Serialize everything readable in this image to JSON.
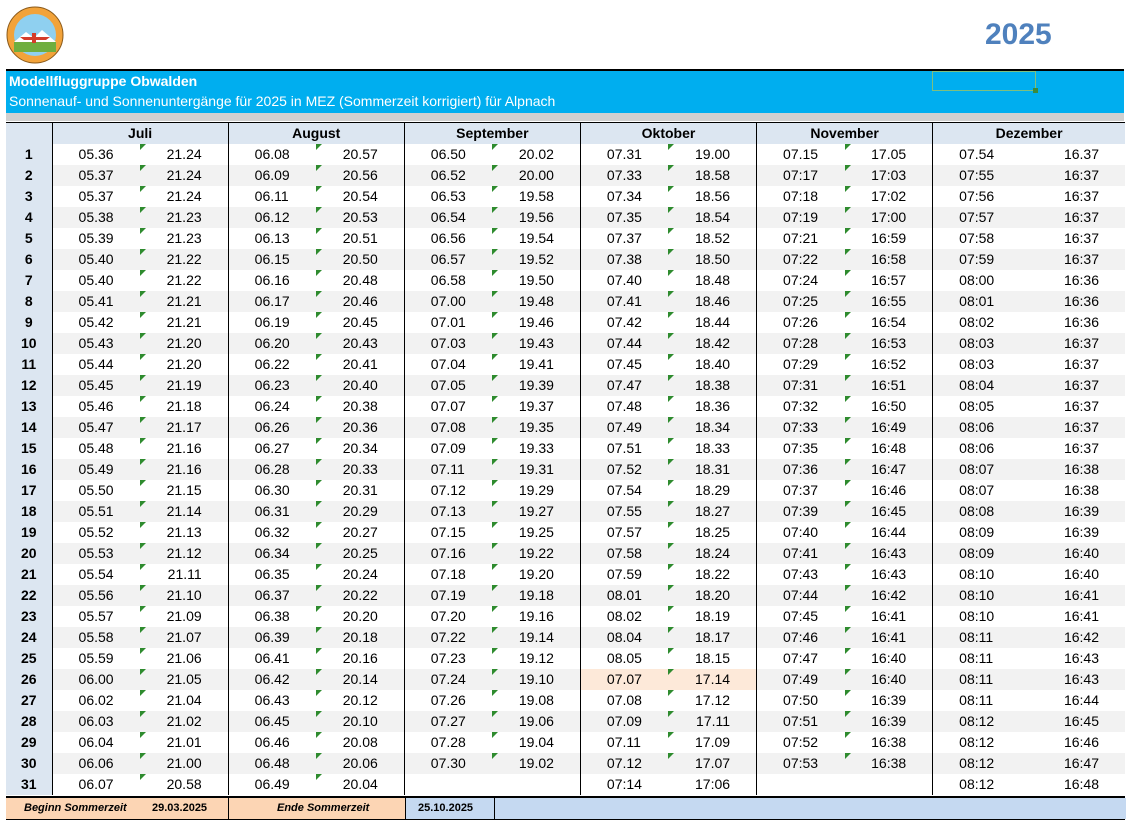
{
  "header": {
    "year": "2025",
    "club": "Modellfluggruppe Obwalden",
    "subtitle": "Sonnenauf- und Sonnenuntergänge für 2025 in MEZ (Sommerzeit korrigiert) für Alpnach"
  },
  "colors": {
    "banner": "#00aeef",
    "year": "#4f81bd",
    "header_bg": "#dce6f1",
    "highlight": "#fde9d9",
    "footer_orange": "#fcd5b4",
    "footer_blue": "#c5d9f1",
    "marker": "#2e8b2e"
  },
  "months": [
    "Juli",
    "August",
    "September",
    "Oktober",
    "November",
    "Dezember"
  ],
  "days": [
    "1",
    "2",
    "3",
    "4",
    "5",
    "6",
    "7",
    "8",
    "9",
    "10",
    "11",
    "12",
    "13",
    "14",
    "15",
    "16",
    "17",
    "18",
    "19",
    "20",
    "21",
    "22",
    "23",
    "24",
    "25",
    "26",
    "27",
    "28",
    "29",
    "30",
    "31"
  ],
  "juli": [
    [
      "05.36",
      "21.24"
    ],
    [
      "05.37",
      "21.24"
    ],
    [
      "05.37",
      "21.24"
    ],
    [
      "05.38",
      "21.23"
    ],
    [
      "05.39",
      "21.23"
    ],
    [
      "05.40",
      "21.22"
    ],
    [
      "05.40",
      "21.22"
    ],
    [
      "05.41",
      "21.21"
    ],
    [
      "05.42",
      "21.21"
    ],
    [
      "05.43",
      "21.20"
    ],
    [
      "05.44",
      "21.20"
    ],
    [
      "05.45",
      "21.19"
    ],
    [
      "05.46",
      "21.18"
    ],
    [
      "05.47",
      "21.17"
    ],
    [
      "05.48",
      "21.16"
    ],
    [
      "05.49",
      "21.16"
    ],
    [
      "05.50",
      "21.15"
    ],
    [
      "05.51",
      "21.14"
    ],
    [
      "05.52",
      "21.13"
    ],
    [
      "05.53",
      "21.12"
    ],
    [
      "05.54",
      "21.11"
    ],
    [
      "05.56",
      "21.10"
    ],
    [
      "05.57",
      "21.09"
    ],
    [
      "05.58",
      "21.07"
    ],
    [
      "05.59",
      "21.06"
    ],
    [
      "06.00",
      "21.05"
    ],
    [
      "06.02",
      "21.04"
    ],
    [
      "06.03",
      "21.02"
    ],
    [
      "06.04",
      "21.01"
    ],
    [
      "06.06",
      "21.00"
    ],
    [
      "06.07",
      "20.58"
    ]
  ],
  "august": [
    [
      "06.08",
      "20.57"
    ],
    [
      "06.09",
      "20.56"
    ],
    [
      "06.11",
      "20.54"
    ],
    [
      "06.12",
      "20.53"
    ],
    [
      "06.13",
      "20.51"
    ],
    [
      "06.15",
      "20.50"
    ],
    [
      "06.16",
      "20.48"
    ],
    [
      "06.17",
      "20.46"
    ],
    [
      "06.19",
      "20.45"
    ],
    [
      "06.20",
      "20.43"
    ],
    [
      "06.22",
      "20.41"
    ],
    [
      "06.23",
      "20.40"
    ],
    [
      "06.24",
      "20.38"
    ],
    [
      "06.26",
      "20.36"
    ],
    [
      "06.27",
      "20.34"
    ],
    [
      "06.28",
      "20.33"
    ],
    [
      "06.30",
      "20.31"
    ],
    [
      "06.31",
      "20.29"
    ],
    [
      "06.32",
      "20.27"
    ],
    [
      "06.34",
      "20.25"
    ],
    [
      "06.35",
      "20.24"
    ],
    [
      "06.37",
      "20.22"
    ],
    [
      "06.38",
      "20.20"
    ],
    [
      "06.39",
      "20.18"
    ],
    [
      "06.41",
      "20.16"
    ],
    [
      "06.42",
      "20.14"
    ],
    [
      "06.43",
      "20.12"
    ],
    [
      "06.45",
      "20.10"
    ],
    [
      "06.46",
      "20.08"
    ],
    [
      "06.48",
      "20.06"
    ],
    [
      "06.49",
      "20.04"
    ]
  ],
  "september": [
    [
      "06.50",
      "20.02"
    ],
    [
      "06.52",
      "20.00"
    ],
    [
      "06.53",
      "19.58"
    ],
    [
      "06.54",
      "19.56"
    ],
    [
      "06.56",
      "19.54"
    ],
    [
      "06.57",
      "19.52"
    ],
    [
      "06.58",
      "19.50"
    ],
    [
      "07.00",
      "19.48"
    ],
    [
      "07.01",
      "19.46"
    ],
    [
      "07.03",
      "19.43"
    ],
    [
      "07.04",
      "19.41"
    ],
    [
      "07.05",
      "19.39"
    ],
    [
      "07.07",
      "19.37"
    ],
    [
      "07.08",
      "19.35"
    ],
    [
      "07.09",
      "19.33"
    ],
    [
      "07.11",
      "19.31"
    ],
    [
      "07.12",
      "19.29"
    ],
    [
      "07.13",
      "19.27"
    ],
    [
      "07.15",
      "19.25"
    ],
    [
      "07.16",
      "19.22"
    ],
    [
      "07.18",
      "19.20"
    ],
    [
      "07.19",
      "19.18"
    ],
    [
      "07.20",
      "19.16"
    ],
    [
      "07.22",
      "19.14"
    ],
    [
      "07.23",
      "19.12"
    ],
    [
      "07.24",
      "19.10"
    ],
    [
      "07.26",
      "19.08"
    ],
    [
      "07.27",
      "19.06"
    ],
    [
      "07.28",
      "19.04"
    ],
    [
      "07.30",
      "19.02"
    ],
    [
      "",
      ""
    ]
  ],
  "oktober": [
    [
      "07.31",
      "19.00"
    ],
    [
      "07.33",
      "18.58"
    ],
    [
      "07.34",
      "18.56"
    ],
    [
      "07.35",
      "18.54"
    ],
    [
      "07.37",
      "18.52"
    ],
    [
      "07.38",
      "18.50"
    ],
    [
      "07.40",
      "18.48"
    ],
    [
      "07.41",
      "18.46"
    ],
    [
      "07.42",
      "18.44"
    ],
    [
      "07.44",
      "18.42"
    ],
    [
      "07.45",
      "18.40"
    ],
    [
      "07.47",
      "18.38"
    ],
    [
      "07.48",
      "18.36"
    ],
    [
      "07.49",
      "18.34"
    ],
    [
      "07.51",
      "18.33"
    ],
    [
      "07.52",
      "18.31"
    ],
    [
      "07.54",
      "18.29"
    ],
    [
      "07.55",
      "18.27"
    ],
    [
      "07.57",
      "18.25"
    ],
    [
      "07.58",
      "18.24"
    ],
    [
      "07.59",
      "18.22"
    ],
    [
      "08.01",
      "18.20"
    ],
    [
      "08.02",
      "18.19"
    ],
    [
      "08.04",
      "18.17"
    ],
    [
      "08.05",
      "18.15"
    ],
    [
      "07.07",
      "17.14"
    ],
    [
      "07.08",
      "17.12"
    ],
    [
      "07.09",
      "17.11"
    ],
    [
      "07.11",
      "17.09"
    ],
    [
      "07.12",
      "17.07"
    ],
    [
      "07:14",
      "17:06"
    ]
  ],
  "november": [
    [
      "07.15",
      "17.05"
    ],
    [
      "07:17",
      "17:03"
    ],
    [
      "07:18",
      "17:02"
    ],
    [
      "07:19",
      "17:00"
    ],
    [
      "07:21",
      "16:59"
    ],
    [
      "07:22",
      "16:58"
    ],
    [
      "07:24",
      "16:57"
    ],
    [
      "07:25",
      "16:55"
    ],
    [
      "07:26",
      "16:54"
    ],
    [
      "07:28",
      "16:53"
    ],
    [
      "07:29",
      "16:52"
    ],
    [
      "07:31",
      "16:51"
    ],
    [
      "07:32",
      "16:50"
    ],
    [
      "07:33",
      "16:49"
    ],
    [
      "07:35",
      "16:48"
    ],
    [
      "07:36",
      "16:47"
    ],
    [
      "07:37",
      "16:46"
    ],
    [
      "07:39",
      "16:45"
    ],
    [
      "07:40",
      "16:44"
    ],
    [
      "07:41",
      "16:43"
    ],
    [
      "07:43",
      "16:43"
    ],
    [
      "07:44",
      "16:42"
    ],
    [
      "07:45",
      "16:41"
    ],
    [
      "07:46",
      "16:41"
    ],
    [
      "07:47",
      "16:40"
    ],
    [
      "07:49",
      "16:40"
    ],
    [
      "07:50",
      "16:39"
    ],
    [
      "07:51",
      "16:39"
    ],
    [
      "07:52",
      "16:38"
    ],
    [
      "07:53",
      "16:38"
    ],
    [
      "",
      ""
    ]
  ],
  "dezember": [
    [
      "07.54",
      "16.37"
    ],
    [
      "07:55",
      "16:37"
    ],
    [
      "07:56",
      "16:37"
    ],
    [
      "07:57",
      "16:37"
    ],
    [
      "07:58",
      "16:37"
    ],
    [
      "07:59",
      "16:37"
    ],
    [
      "08:00",
      "16:36"
    ],
    [
      "08:01",
      "16:36"
    ],
    [
      "08:02",
      "16:36"
    ],
    [
      "08:03",
      "16:37"
    ],
    [
      "08:03",
      "16:37"
    ],
    [
      "08:04",
      "16:37"
    ],
    [
      "08:05",
      "16:37"
    ],
    [
      "08:06",
      "16:37"
    ],
    [
      "08:06",
      "16:37"
    ],
    [
      "08:07",
      "16:38"
    ],
    [
      "08:07",
      "16:38"
    ],
    [
      "08:08",
      "16:39"
    ],
    [
      "08:09",
      "16:39"
    ],
    [
      "08:09",
      "16:40"
    ],
    [
      "08:10",
      "16:40"
    ],
    [
      "08:10",
      "16:41"
    ],
    [
      "08:10",
      "16:41"
    ],
    [
      "08:11",
      "16:42"
    ],
    [
      "08:11",
      "16:43"
    ],
    [
      "08:11",
      "16:43"
    ],
    [
      "08:11",
      "16:44"
    ],
    [
      "08:12",
      "16:45"
    ],
    [
      "08:12",
      "16:46"
    ],
    [
      "08:12",
      "16:47"
    ],
    [
      "08:12",
      "16:48"
    ]
  ],
  "highlight": {
    "month": "oktober",
    "day": 26
  },
  "footer": {
    "start_label": "Beginn Sommerzeit",
    "start_value": "29.03.2025",
    "end_label": "Ende Sommerzeit",
    "end_value": "25.10.2025"
  }
}
